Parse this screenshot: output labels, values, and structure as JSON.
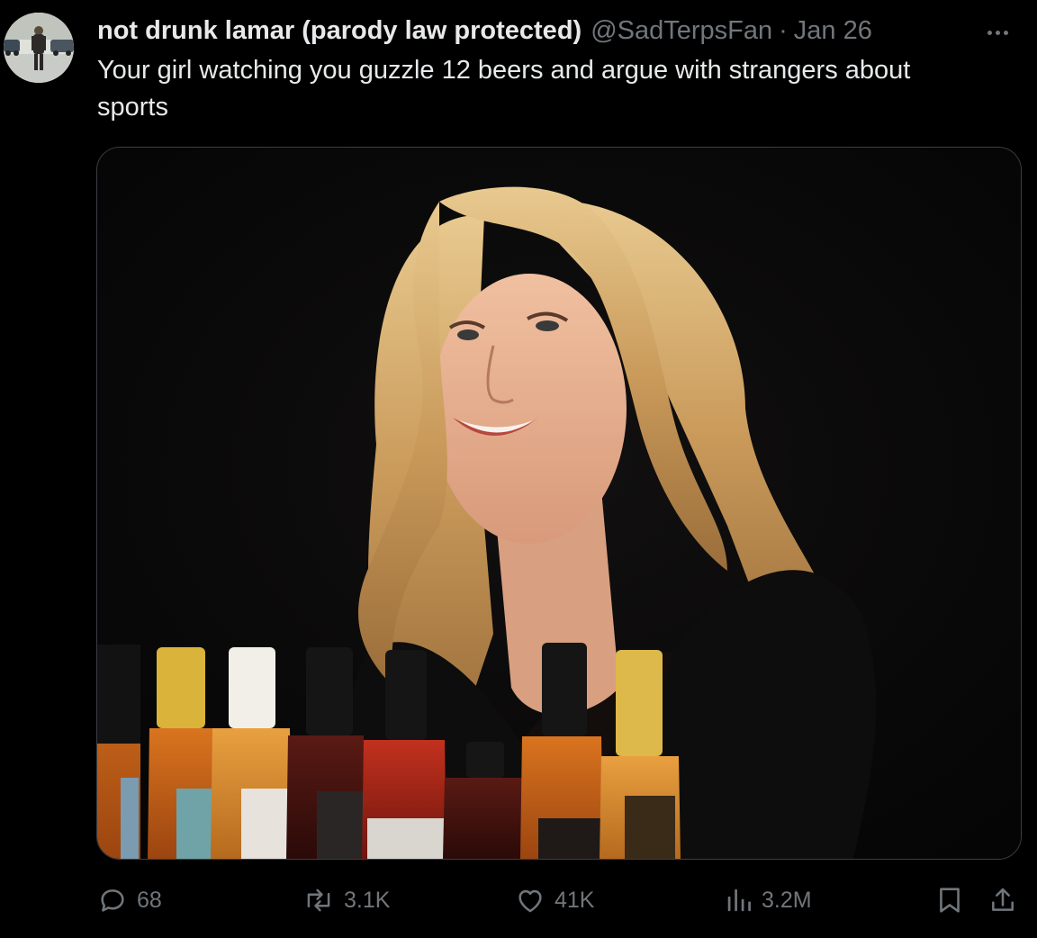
{
  "tweet": {
    "author": {
      "display_name": "not drunk lamar (parody law protected)",
      "handle": "@SadTerpsFan",
      "avatar_icon": "avatar-photo"
    },
    "separator": "·",
    "date": "Jan 26",
    "text": "Your girl watching you guzzle 12 beers and argue with strangers about sports",
    "media": {
      "type": "photo",
      "icon": "photo-image"
    },
    "actions": {
      "replies": {
        "icon": "reply-icon",
        "count": "68"
      },
      "reposts": {
        "icon": "repost-icon",
        "count": "3.1K"
      },
      "likes": {
        "icon": "like-icon",
        "count": "41K"
      },
      "views": {
        "icon": "views-icon",
        "count": "3.2M"
      },
      "bookmark": {
        "icon": "bookmark-icon"
      },
      "share": {
        "icon": "share-icon"
      }
    },
    "more_menu": {
      "icon": "more-icon"
    }
  },
  "colors": {
    "background": "#000000",
    "primary_text": "#e7e9ea",
    "secondary_text": "#71767b",
    "media_border": "#3a3f44"
  }
}
